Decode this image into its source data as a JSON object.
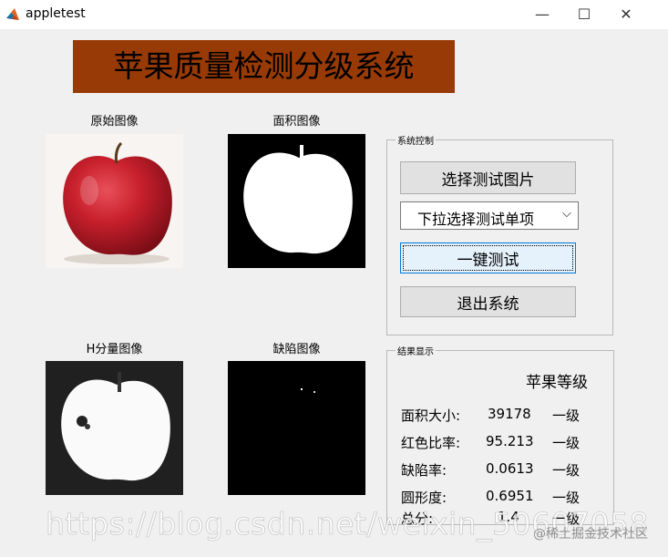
{
  "window": {
    "title": "appletest",
    "controls": {
      "minimize": "—",
      "maximize": "☐",
      "close": "✕"
    }
  },
  "main": {
    "title": "苹果质量检测分级系统",
    "title_bg": "#983a05",
    "images": [
      {
        "label": "原始图像"
      },
      {
        "label": "面积图像"
      },
      {
        "label": "H分量图像"
      },
      {
        "label": "缺陷图像"
      }
    ]
  },
  "control_panel": {
    "title": "系统控制",
    "select_image_button": "选择测试图片",
    "dropdown": {
      "selected": "下拉选择测试单项"
    },
    "one_click_button": "一键测试",
    "exit_button": "退出系统"
  },
  "results_panel": {
    "title": "结果显示",
    "header": "苹果等级",
    "rows": [
      {
        "label": "面积大小:",
        "value": "39178",
        "grade": "一级"
      },
      {
        "label": "红色比率:",
        "value": "95.213",
        "grade": "一级"
      },
      {
        "label": "缺陷率:",
        "value": "0.0613",
        "grade": "一级"
      },
      {
        "label": "圆形度:",
        "value": "0.6951",
        "grade": "一级"
      },
      {
        "label": "总分:",
        "value": "1.4",
        "grade": "一级"
      }
    ]
  },
  "watermark": {
    "url": "https://blog.csdn.net/weixin_50607058",
    "source": "@稀土掘金技术社区"
  }
}
